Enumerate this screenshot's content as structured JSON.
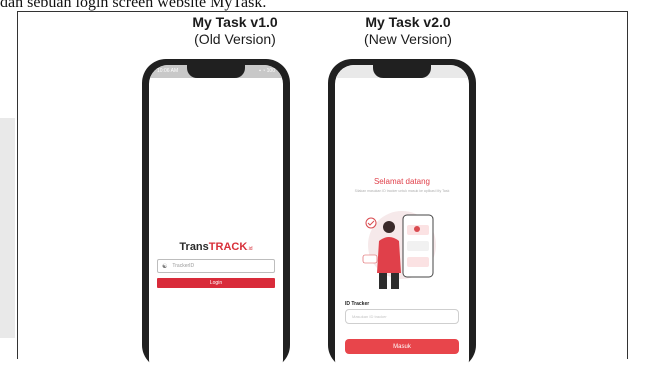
{
  "caption": "dan sebuah login screen website MyTask.",
  "left": {
    "version_title": "My Task v1.0",
    "version_subtitle": "(Old Version)",
    "status_time": "10:06 AM",
    "status_icons": "▪ ◔ 100",
    "logo_prefix": "Trans",
    "logo_brand": "TRACK",
    "logo_suffix": ".id",
    "tracker_placeholder": "TrackerID",
    "login_label": "Login",
    "accent": "#d92b3a"
  },
  "right": {
    "version_title": "My Task v2.0",
    "version_subtitle": "(New Version)",
    "welcome": "Selamat datang",
    "blurb": "Silakan masukan ID tracker untuk masuk ke aplikasi My Task",
    "id_label": "ID Tracker",
    "id_placeholder": "Masukan ID tracker",
    "button_label": "Masuk",
    "accent": "#e8454b",
    "illustration_icon": "person-with-phone-illustration"
  }
}
